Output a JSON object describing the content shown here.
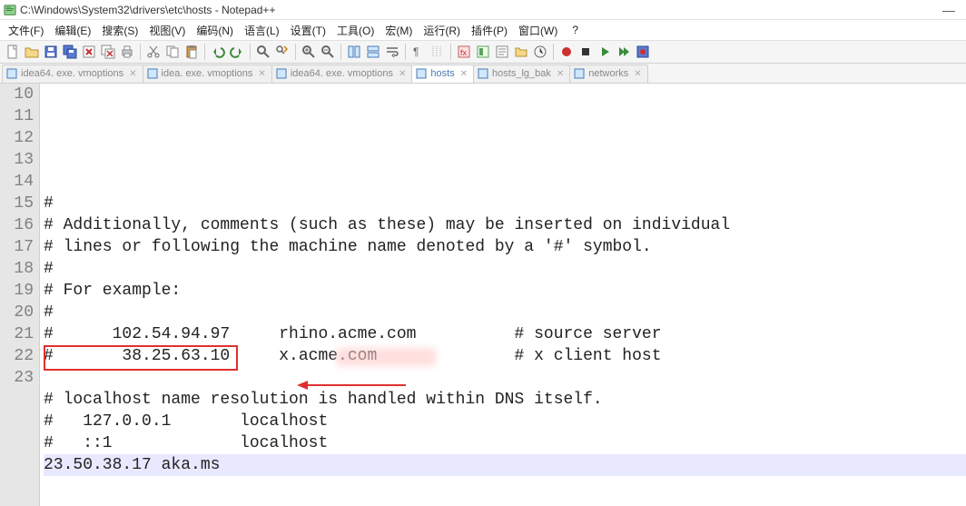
{
  "titlebar": {
    "title": "C:\\Windows\\System32\\drivers\\etc\\hosts - Notepad++"
  },
  "menubar": {
    "items": [
      "文件(F)",
      "编辑(E)",
      "搜索(S)",
      "视图(V)",
      "编码(N)",
      "语言(L)",
      "设置(T)",
      "工具(O)",
      "宏(M)",
      "运行(R)",
      "插件(P)",
      "窗口(W)"
    ],
    "help": "?"
  },
  "file_tabs": [
    {
      "label": "idea64. exe. vmoptions",
      "active": false
    },
    {
      "label": "idea. exe. vmoptions",
      "active": false
    },
    {
      "label": "idea64. exe. vmoptions",
      "active": false
    },
    {
      "label": "hosts",
      "active": true
    },
    {
      "label": "hosts_lg_bak",
      "active": false
    },
    {
      "label": "networks",
      "active": false
    }
  ],
  "editor": {
    "first_line_no": 10,
    "lines": [
      "#",
      "# Additionally, comments (such as these) may be inserted on individual",
      "# lines or following the machine name denoted by a '#' symbol.",
      "#",
      "# For example:",
      "#",
      "#      102.54.94.97     rhino.acme.com          # source server",
      "#       38.25.63.10     x.acme.com              # x client host",
      "",
      "# localhost name resolution is handled within DNS itself.",
      "#   127.0.0.1       localhost",
      "#   ::1             localhost",
      "23.50.38.17 aka.ms",
      ""
    ],
    "selected_index": 12
  }
}
